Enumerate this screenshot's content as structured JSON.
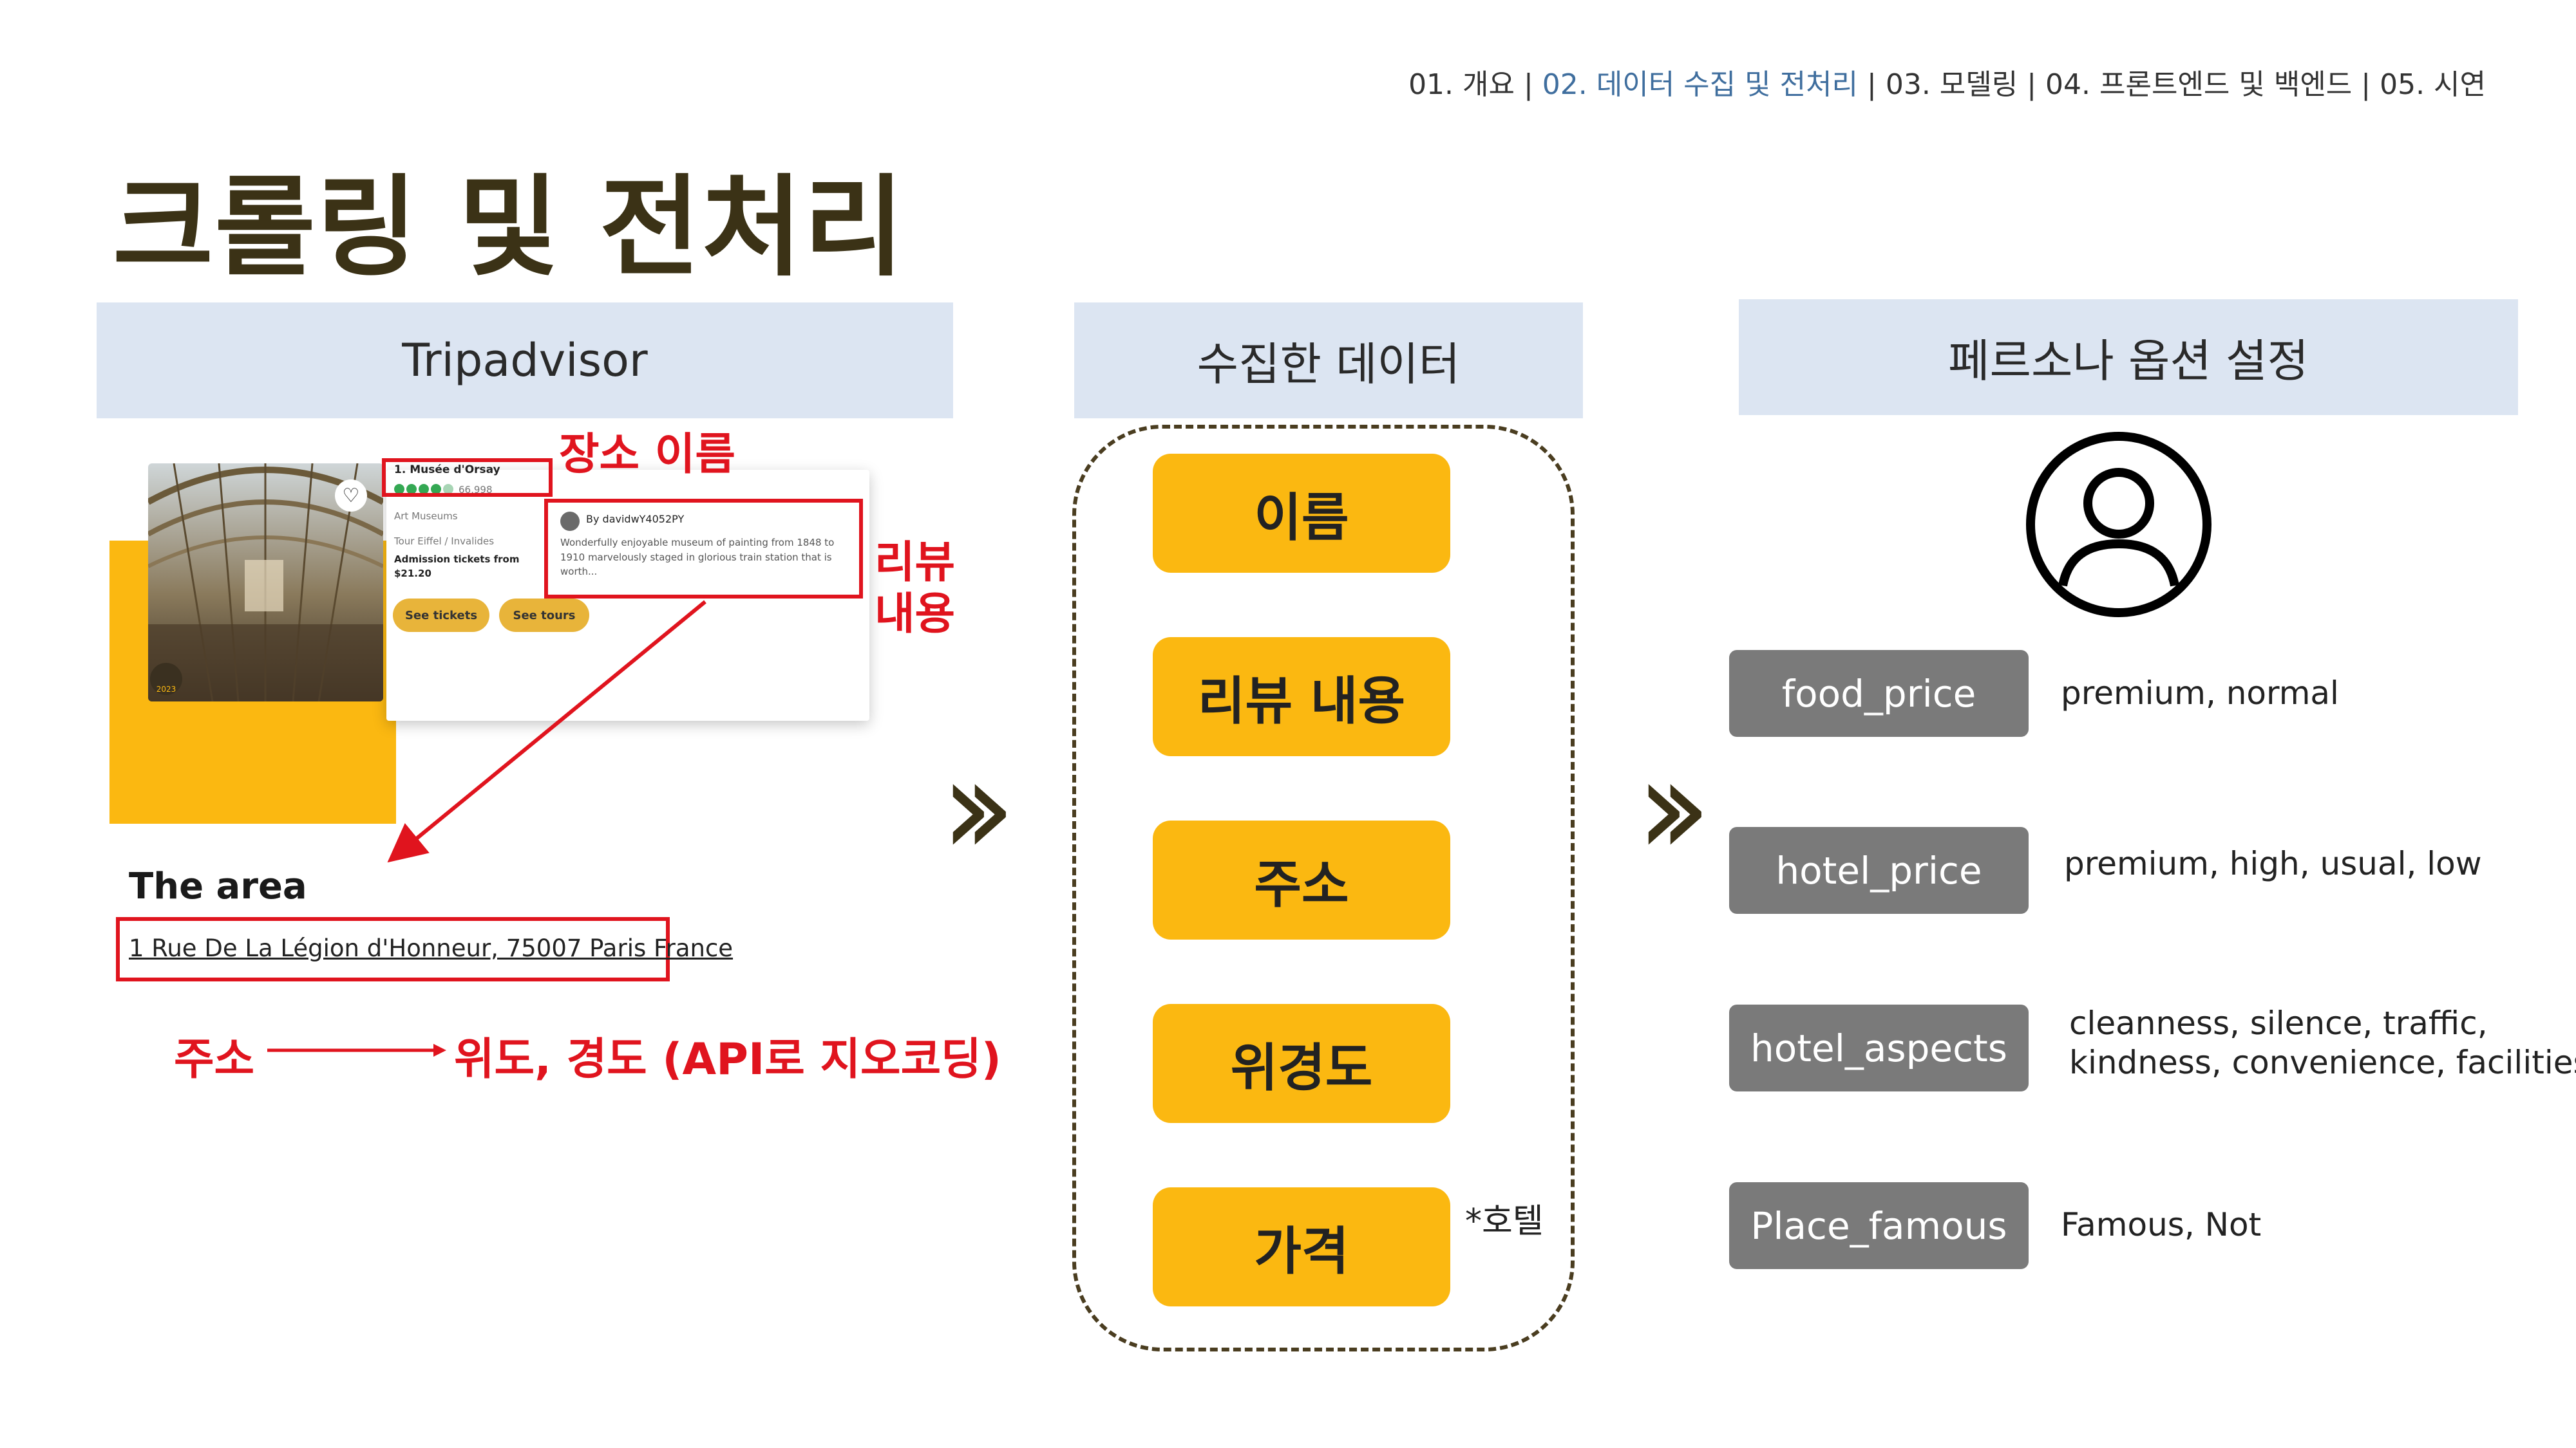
{
  "nav": {
    "pre": "01. 개요 | ",
    "active": "02. 데이터 수집 및 전처리",
    "post": " | 03. 모델링 | 04. 프론트엔드 및 백엔드 | 05. 시연"
  },
  "title": "크롤링 및 전처리",
  "columns": {
    "left": "Tripadvisor",
    "middle": "수집한 데이터",
    "right": "페르소나 옵션 설정"
  },
  "tripadvisor_card": {
    "place_name": "1. Musée d'Orsay",
    "review_count": "66,998",
    "category": "Art Museums",
    "location": "Tour Eiffel / Invalides",
    "tickets_label": "Admission tickets from",
    "tickets_price": "$21.20",
    "see_tickets": "See tickets",
    "see_tours": "See tours",
    "reviewer": "By davidwY4052PY",
    "review_text": "Wonderfully enjoyable museum of painting from 1848 to 1910 marvelously staged in glorious train station that is worth...",
    "badge_year": "2023"
  },
  "annotations": {
    "place_name": "장소 이름",
    "review": "리뷰\n내용",
    "address_to": "주소",
    "geocode": "위도, 경도 (API로 지오코딩)"
  },
  "area": {
    "heading": "The area",
    "address": "1 Rue De La Légion d'Honneur, 75007 Paris France"
  },
  "collected": [
    "이름",
    "리뷰 내용",
    "주소",
    "위경도",
    "가격"
  ],
  "hotel_note": "*호텔",
  "options": [
    {
      "key": "food_price",
      "values": "premium, normal"
    },
    {
      "key": "hotel_price",
      "values": "premium, high, usual, low"
    },
    {
      "key": "hotel_aspects",
      "values": "cleanness, silence, traffic,\nkindness, convenience, facilities"
    },
    {
      "key": "Place_famous",
      "values": "Famous, Not"
    }
  ],
  "colors": {
    "accent_yellow": "#fbb811",
    "annotation_red": "#e0141e",
    "header_blue": "#dce5f2",
    "option_gray": "#7a7a7a",
    "title_brown": "#3b3216"
  },
  "icons": [
    "user-icon",
    "heart-icon",
    "chevron-right-icon"
  ]
}
